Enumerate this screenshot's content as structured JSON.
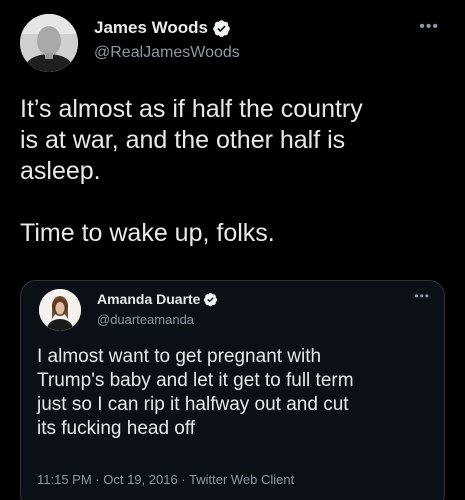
{
  "tweet": {
    "author_name": "James Woods",
    "author_handle": "@RealJamesWoods",
    "more_icon": "more-horizontal-icon",
    "verified_icon": "verified-badge-icon",
    "text": "It’s almost as if half the country\nis at war, and the other half is\nasleep.\n\nTime to wake up, folks."
  },
  "quoted_tweet": {
    "author_name": "Amanda Duarte",
    "author_handle": "@duarteamanda",
    "more_icon": "more-horizontal-icon",
    "verified_icon": "verified-badge-icon",
    "text": "I almost want to get pregnant with\nTrump's baby and let it get to full term\njust so I can rip it halfway out and cut\nits fucking head off",
    "meta": "11:15 PM · Oct 19, 2016 · Twitter Web Client"
  },
  "colors": {
    "background": "#000000",
    "text_primary": "#e7e9ea",
    "text_secondary": "#8b98a5",
    "verified_blue": "#1d9bf0",
    "quote_border": "#2f3336"
  }
}
